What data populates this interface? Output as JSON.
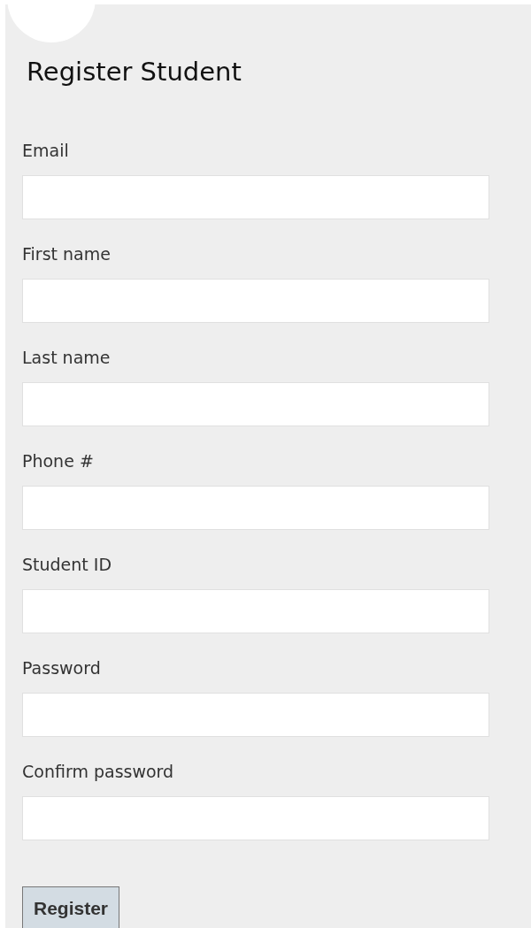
{
  "title": "Register Student",
  "fields": [
    {
      "label": "Email"
    },
    {
      "label": "First name"
    },
    {
      "label": "Last name"
    },
    {
      "label": "Phone #"
    },
    {
      "label": "Student ID"
    },
    {
      "label": "Password"
    },
    {
      "label": "Confirm password"
    }
  ],
  "submit_button": "Register"
}
